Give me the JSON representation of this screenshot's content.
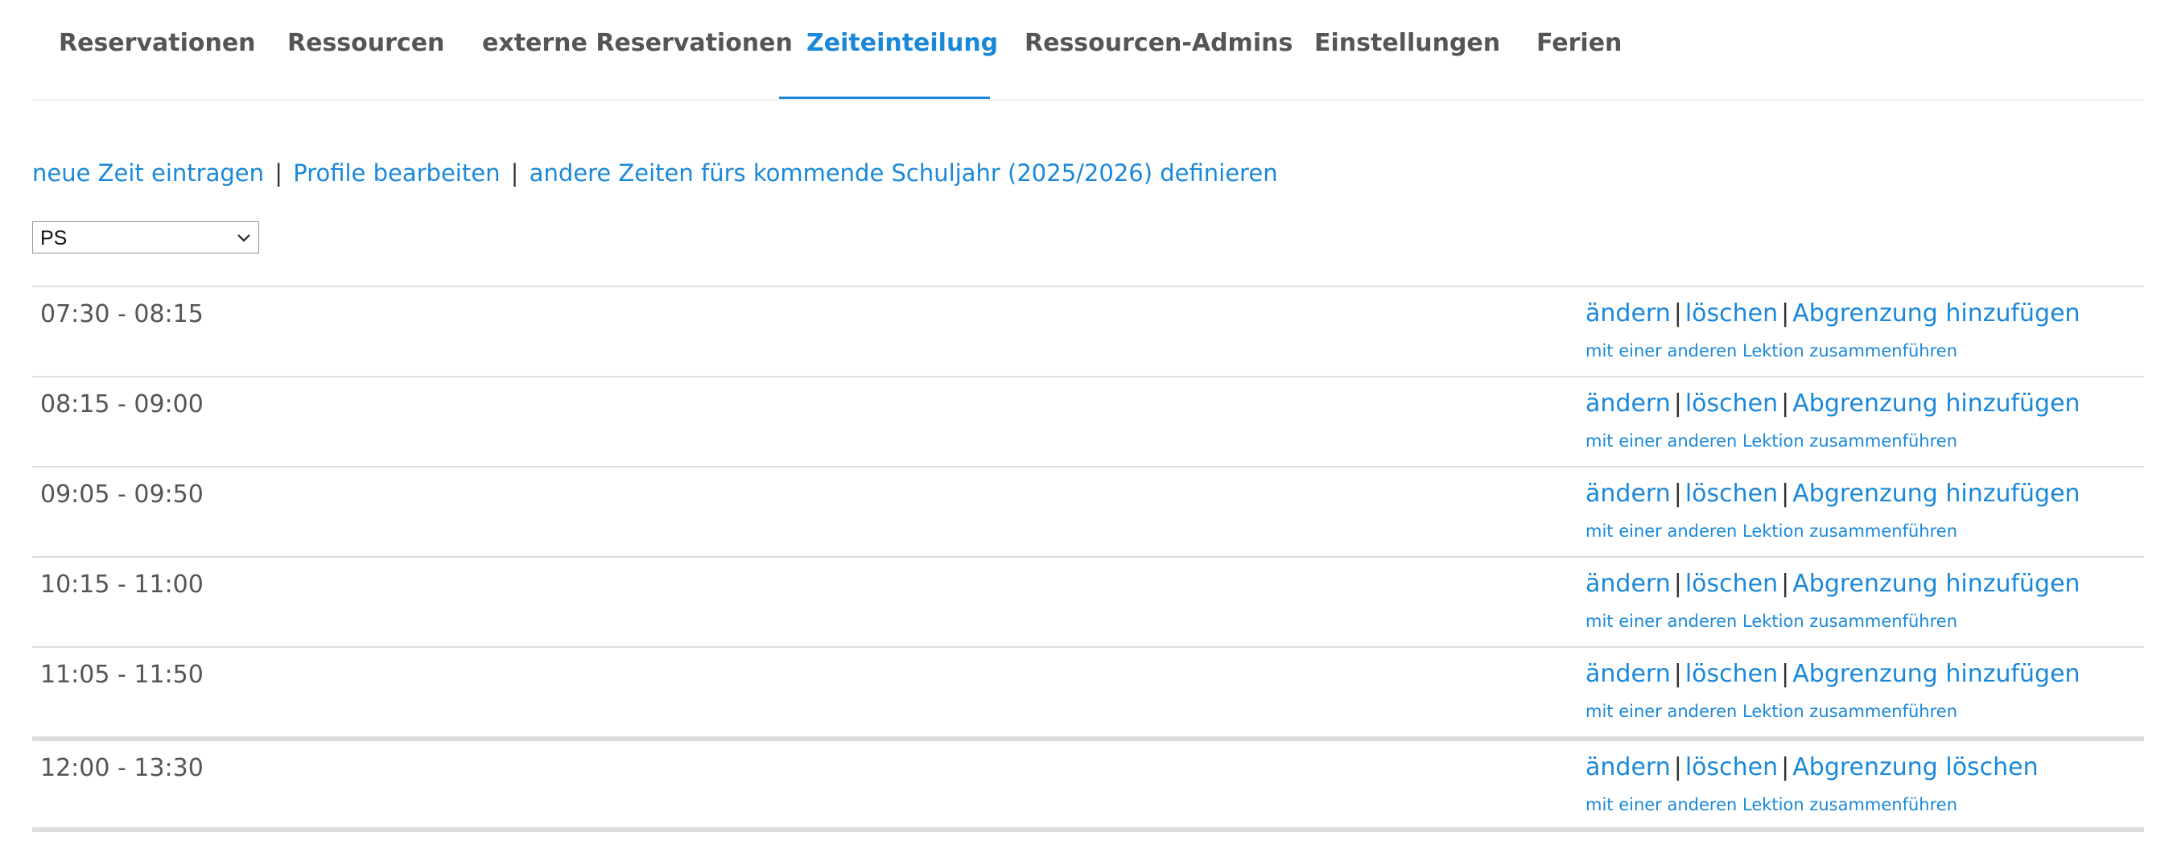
{
  "tabs": [
    {
      "label": "Reservationen"
    },
    {
      "label": "Ressourcen"
    },
    {
      "label": "externe Reservationen"
    },
    {
      "label": "Zeiteinteilung",
      "active": true
    },
    {
      "label": "Ressourcen-Admins"
    },
    {
      "label": "Einstellungen"
    },
    {
      "label": "Ferien"
    }
  ],
  "actions": {
    "new_time": "neue Zeit eintragen",
    "edit_profiles": "Profile bearbeiten",
    "next_year": "andere Zeiten fürs kommende Schuljahr (2025/2026) definieren",
    "separator": "|"
  },
  "profile_select": {
    "value": "PS",
    "icon": "chevron-down-icon"
  },
  "row_links": {
    "edit": "ändern",
    "delete": "löschen",
    "separator": "|",
    "merge": "mit einer anderen Lektion zusammenführen"
  },
  "rows": [
    {
      "time": "07:30 - 08:15",
      "boundary": "Abgrenzung hinzufügen"
    },
    {
      "time": "08:15 - 09:00",
      "boundary": "Abgrenzung hinzufügen"
    },
    {
      "time": "09:05 - 09:50",
      "boundary": "Abgrenzung hinzufügen"
    },
    {
      "time": "10:15 - 11:00",
      "boundary": "Abgrenzung hinzufügen"
    },
    {
      "time": "11:05 - 11:50",
      "boundary": "Abgrenzung hinzufügen"
    },
    {
      "time": "12:00 - 13:30",
      "boundary": "Abgrenzung löschen"
    }
  ],
  "colors": {
    "accent": "#1a88d8",
    "text": "#555555",
    "divider": "#dddddd"
  }
}
